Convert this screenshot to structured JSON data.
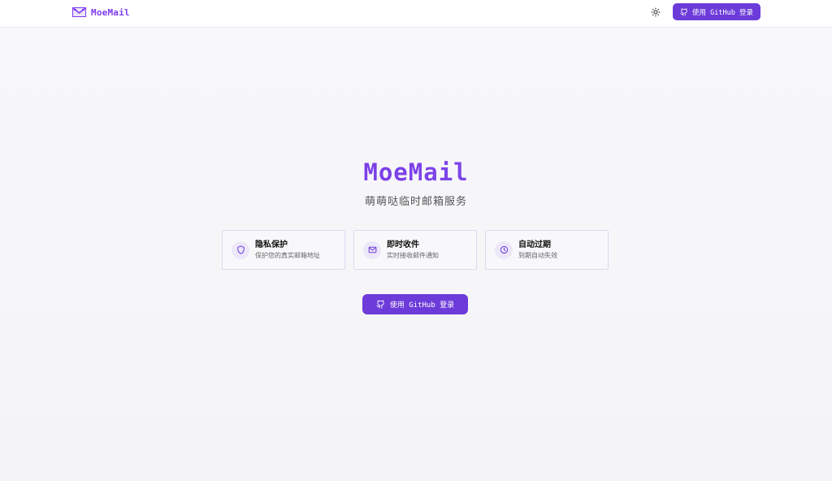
{
  "header": {
    "logo_text": "MoeMail",
    "logo_icon": "mail-envelope-icon",
    "theme_icon": "sun-icon",
    "login_label": "使用 GitHub 登录"
  },
  "hero": {
    "title": "MoeMail",
    "subtitle": "萌萌哒临时邮箱服务"
  },
  "features": [
    {
      "icon": "shield-icon",
      "title": "隐私保护",
      "desc": "保护您的真实邮箱地址"
    },
    {
      "icon": "mail-icon",
      "title": "即时收件",
      "desc": "实时接收邮件通知"
    },
    {
      "icon": "clock-icon",
      "title": "自动过期",
      "desc": "到期自动失效"
    }
  ],
  "cta": {
    "login_label": "使用 GitHub 登录"
  },
  "colors": {
    "accent": "#6c3bd9",
    "brand": "#7c3aed",
    "background": "#f6f6f9"
  }
}
